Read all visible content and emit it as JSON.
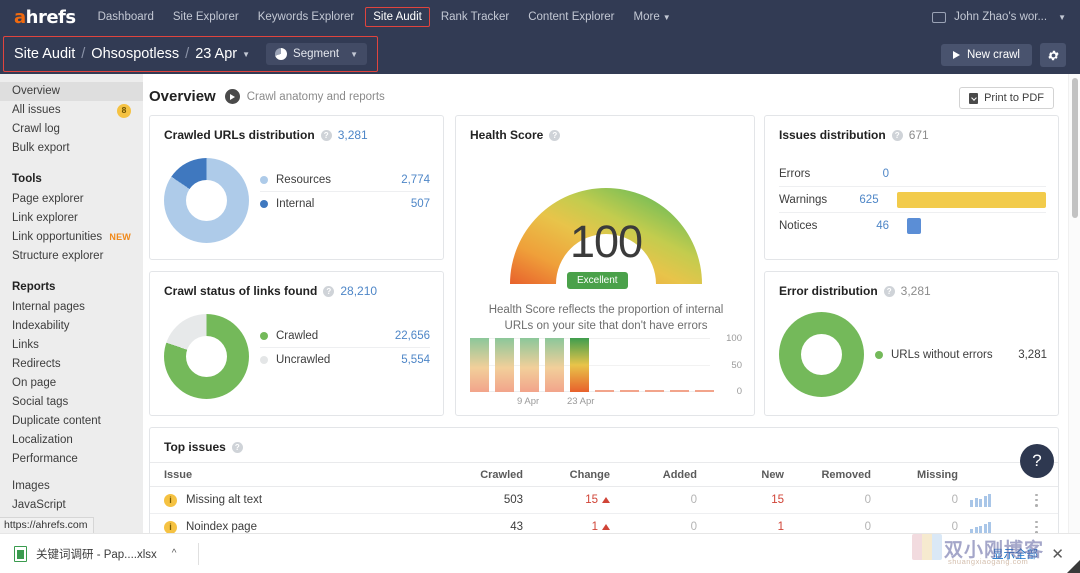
{
  "topnav": {
    "logo": "ahrefs",
    "items": [
      {
        "label": "Dashboard",
        "active": false
      },
      {
        "label": "Site Explorer",
        "active": false
      },
      {
        "label": "Keywords Explorer",
        "active": false
      },
      {
        "label": "Site Audit",
        "active": true
      },
      {
        "label": "Rank Tracker",
        "active": false
      },
      {
        "label": "Content Explorer",
        "active": false
      },
      {
        "label": "More",
        "active": false
      }
    ],
    "user": "John Zhao's wor..."
  },
  "breadcrumb": {
    "root": "Site Audit",
    "project": "Ohsospotless",
    "date": "23 Apr",
    "segment_label": "Segment",
    "new_crawl_label": "New crawl"
  },
  "page": {
    "title": "Overview",
    "subtitle": "Crawl anatomy and reports",
    "print_label": "Print to PDF"
  },
  "sidebar": {
    "items": [
      {
        "label": "Overview",
        "active": true
      },
      {
        "label": "All issues",
        "badge": "8"
      },
      {
        "label": "Crawl log"
      },
      {
        "label": "Bulk export"
      }
    ],
    "tools_heading": "Tools",
    "tools": [
      {
        "label": "Page explorer"
      },
      {
        "label": "Link explorer"
      },
      {
        "label": "Link opportunities",
        "tag": "NEW"
      },
      {
        "label": "Structure explorer"
      }
    ],
    "reports_heading": "Reports",
    "reports": [
      {
        "label": "Internal pages"
      },
      {
        "label": "Indexability"
      },
      {
        "label": "Links"
      },
      {
        "label": "Redirects"
      },
      {
        "label": "On page"
      },
      {
        "label": "Social tags"
      },
      {
        "label": "Duplicate content"
      },
      {
        "label": "Localization"
      },
      {
        "label": "Performance"
      }
    ],
    "extra": [
      {
        "label": "Images"
      },
      {
        "label": "JavaScript"
      }
    ],
    "status_url": "https://ahrefs.com"
  },
  "chart_data": [
    {
      "type": "pie",
      "title": "Crawled URLs distribution",
      "total": "3,281",
      "categories": [
        "Resources",
        "Internal"
      ],
      "values": [
        2774,
        507
      ],
      "value_labels": [
        "2,774",
        "507"
      ],
      "colors": [
        "#aecbe9",
        "#3f78bf"
      ]
    },
    {
      "type": "pie",
      "title": "Crawl status of links found",
      "total": "28,210",
      "categories": [
        "Crawled",
        "Uncrawled"
      ],
      "values": [
        22656,
        5554
      ],
      "value_labels": [
        "22,656",
        "5,554"
      ],
      "colors": [
        "#74b95a",
        "#e7e9ea"
      ]
    },
    {
      "type": "bar",
      "title": "Health Score",
      "score": "100",
      "badge": "Excellent",
      "description": "Health Score reflects the proportion of internal URLs on your site that don't have errors",
      "categories": [
        "",
        "",
        "",
        "",
        "",
        "",
        "",
        "",
        "",
        ""
      ],
      "values": [
        100,
        100,
        100,
        100,
        100,
        1,
        1,
        1,
        1,
        1
      ],
      "xticks": [
        "9 Apr",
        "23 Apr"
      ],
      "yticks": [
        "100",
        "50",
        "0"
      ],
      "ylim": [
        0,
        100
      ]
    },
    {
      "type": "bar",
      "title": "Issues distribution",
      "total": "671",
      "categories": [
        "Errors",
        "Warnings",
        "Notices"
      ],
      "values": [
        0,
        625,
        46
      ],
      "value_labels": [
        "0",
        "625",
        "46"
      ],
      "colors": [
        "#e0443e",
        "#f2cb4b",
        "#5b8ed6"
      ],
      "max": 625
    },
    {
      "type": "pie",
      "title": "Error distribution",
      "total": "3,281",
      "categories": [
        "URLs without errors"
      ],
      "values": [
        3281
      ],
      "value_labels": [
        "3,281"
      ],
      "colors": [
        "#74b95a"
      ]
    }
  ],
  "cards": {
    "crawled_urls": {
      "title": "Crawled URLs distribution",
      "count": "3,281",
      "legend": [
        {
          "label": "Resources",
          "value": "2,774",
          "color": "#aecbe9"
        },
        {
          "label": "Internal",
          "value": "507",
          "color": "#3f78bf"
        }
      ]
    },
    "crawl_status": {
      "title": "Crawl status of links found",
      "count": "28,210",
      "legend": [
        {
          "label": "Crawled",
          "value": "22,656",
          "color": "#74b95a"
        },
        {
          "label": "Uncrawled",
          "value": "5,554",
          "color": "#e4e6e7"
        }
      ]
    },
    "health_score": {
      "title": "Health Score",
      "score": "100",
      "badge": "Excellent",
      "description": "Health Score reflects the proportion of internal URLs on your site that don't have errors",
      "xticks": [
        "9 Apr",
        "23 Apr"
      ],
      "yticks": [
        "100",
        "50",
        "0"
      ]
    },
    "issues_distribution": {
      "title": "Issues distribution",
      "count": "671",
      "rows": [
        {
          "label": "Errors",
          "value": "0",
          "width": 0,
          "color": "#e0443e"
        },
        {
          "label": "Warnings",
          "value": "625",
          "width": 165,
          "color": "#f2cb4b"
        },
        {
          "label": "Notices",
          "value": "46",
          "width": 14,
          "color": "#5b8ed6"
        }
      ]
    },
    "error_distribution": {
      "title": "Error distribution",
      "count": "3,281",
      "legend": [
        {
          "label": "URLs without errors",
          "value": "3,281",
          "color": "#74b95a"
        }
      ]
    }
  },
  "top_issues": {
    "title": "Top issues",
    "columns": [
      "Issue",
      "Crawled",
      "Change",
      "Added",
      "New",
      "Removed",
      "Missing"
    ],
    "rows": [
      {
        "issue": "Missing alt text",
        "crawled": "503",
        "change": "15",
        "added": "0",
        "new": "15",
        "removed": "0",
        "missing": "0",
        "spark": [
          7,
          9,
          8,
          11,
          13
        ]
      },
      {
        "issue": "Noindex page",
        "crawled": "43",
        "change": "1",
        "added": "0",
        "new": "1",
        "removed": "0",
        "missing": "0",
        "spark": [
          5,
          7,
          8,
          10,
          12
        ]
      }
    ]
  },
  "help": {
    "label": "?"
  },
  "taskbar": {
    "download_name": "关键词调研 - Pap....xlsx",
    "show_all": "显示全部",
    "close": "✕"
  },
  "watermark": {
    "text": "双小刚博客",
    "sub": "shuangxiaogang.com"
  }
}
